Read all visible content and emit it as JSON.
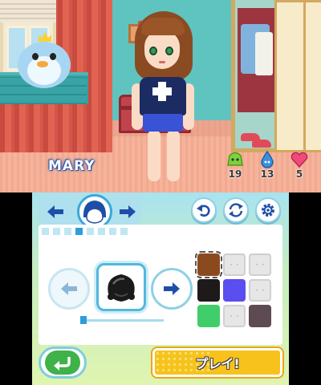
{
  "top_screen": {
    "character_name": "MARY",
    "stats": [
      {
        "icon": "green-creature-icon",
        "value": "19",
        "color": "#7fd13a"
      },
      {
        "icon": "blue-drop-icon",
        "value": "13",
        "color": "#3a8fe0"
      },
      {
        "icon": "pink-heart-icon",
        "value": "5",
        "color": "#f04a7a"
      }
    ]
  },
  "bottom_screen": {
    "tabs": {
      "prev_icon": "arrow-left-icon",
      "current_icon": "hair-category-icon",
      "next_icon": "arrow-right-icon"
    },
    "toolbar": {
      "undo_icon": "undo-icon",
      "randomize_icon": "shuffle-icon",
      "settings_icon": "gear-icon"
    },
    "page_indicator": {
      "total": 8,
      "current": 4
    },
    "selector": {
      "prev_icon": "arrow-left-icon",
      "next_icon": "arrow-right-icon",
      "preview": "hairstyle-preview",
      "slider_value": 0
    },
    "color_swatches": [
      {
        "color": "#8b4a1e",
        "selected": true
      },
      {
        "color": null
      },
      {
        "color": null
      },
      {
        "color": "#1e1a1a"
      },
      {
        "color": "#5a4ef0"
      },
      {
        "color": null
      },
      {
        "color": "#3fce6a"
      },
      {
        "color": null
      },
      {
        "color": "#5e4a52"
      }
    ],
    "back_icon": "return-arrow-icon",
    "play_label": "プレイ!"
  },
  "colors": {
    "accent_blue": "#2f9ed8",
    "play_yellow": "#f7c21b",
    "back_green": "#3fb24a"
  }
}
